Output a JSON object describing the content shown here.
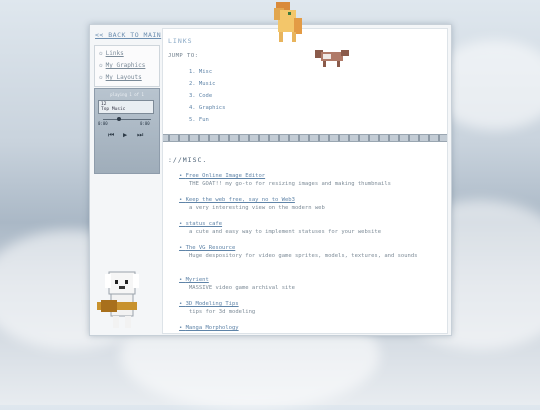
{
  "sidebar": {
    "back_link": "<< BACK TO MAIN",
    "nav": [
      "Links",
      "My Graphics",
      "My Layouts"
    ]
  },
  "player": {
    "header": "playing 1 of 1",
    "track_num": "12",
    "track_name": "Top Music",
    "time_start": "0:00",
    "time_end": "0:00"
  },
  "main": {
    "heading": "LINKS",
    "jump_label": "JUMP TO:",
    "toc": [
      "1. Misc",
      "2. Music",
      "3. Code",
      "4. Graphics",
      "5. Fun"
    ],
    "section_title": "://MISC.",
    "entries": [
      {
        "title": "Free Online Image Editor",
        "desc": "THE GOAT!! my go-to for resizing images and making thumbnails"
      },
      {
        "title": "Keep the web free, say no to Web3",
        "desc": "a very interesting view on the modern web"
      },
      {
        "title": "status cafe",
        "desc": "a cute and easy way to implement statuses for your website"
      },
      {
        "title": "The VG Resource",
        "desc": "Huge despository for video game sprites, models, textures, and sounds"
      },
      {
        "title": "Myrient",
        "desc": "MASSIVE video game archival site"
      },
      {
        "title": "3D Modeling Tips",
        "desc": "tips for 3d modeling"
      },
      {
        "title": "Manga Morphology",
        "desc": ""
      }
    ]
  },
  "colors": {
    "accent": "#5f84a8",
    "frame": "#f4f6f8"
  }
}
